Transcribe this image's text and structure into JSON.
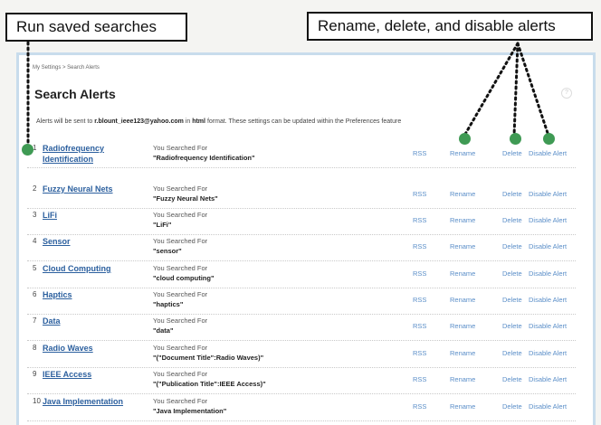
{
  "callouts": {
    "left": "Run saved searches",
    "right": "Rename, delete, and disable alerts"
  },
  "page": {
    "breadcrumb": "My Settings > Search Alerts",
    "title": "Search Alerts",
    "help": "?"
  },
  "intro": {
    "prefix": "Alerts will be sent to",
    "email": "r.blount_ieee123@yahoo.com",
    "middle": "in",
    "format": "html",
    "suffix": "format. These settings can be updated within the Preferences feature"
  },
  "labels": {
    "you_searched_for": "You Searched For",
    "rss": "RSS",
    "rename": "Rename",
    "delete": "Delete",
    "disable": "Disable Alert"
  },
  "alerts": [
    {
      "num": "1",
      "name": "Radiofrequency Identification",
      "query": "\"Radiofrequency Identification\""
    },
    {
      "num": "2",
      "name": "Fuzzy Neural Nets",
      "query": "\"Fuzzy Neural Nets\""
    },
    {
      "num": "3",
      "name": "LiFi",
      "query": "\"LiFi\""
    },
    {
      "num": "4",
      "name": "Sensor",
      "query": "\"sensor\""
    },
    {
      "num": "5",
      "name": "Cloud Computing",
      "query": "\"cloud computing\""
    },
    {
      "num": "6",
      "name": "Haptics",
      "query": "\"haptics\""
    },
    {
      "num": "7",
      "name": "Data",
      "query": "\"data\""
    },
    {
      "num": "8",
      "name": "Radio Waves",
      "query": "\"(\"Document Title\":Radio Waves)\""
    },
    {
      "num": "9",
      "name": "IEEE Access",
      "query": "\"(\"Publication Title\":IEEE Access)\""
    },
    {
      "num": "10",
      "name": "Java Implementation",
      "query": "\"Java Implementation\""
    }
  ],
  "colors": {
    "link": "#2b5f9e",
    "action_link": "#5a8ec8",
    "marker": "#3f9a54",
    "frame": "#c8dcec"
  }
}
